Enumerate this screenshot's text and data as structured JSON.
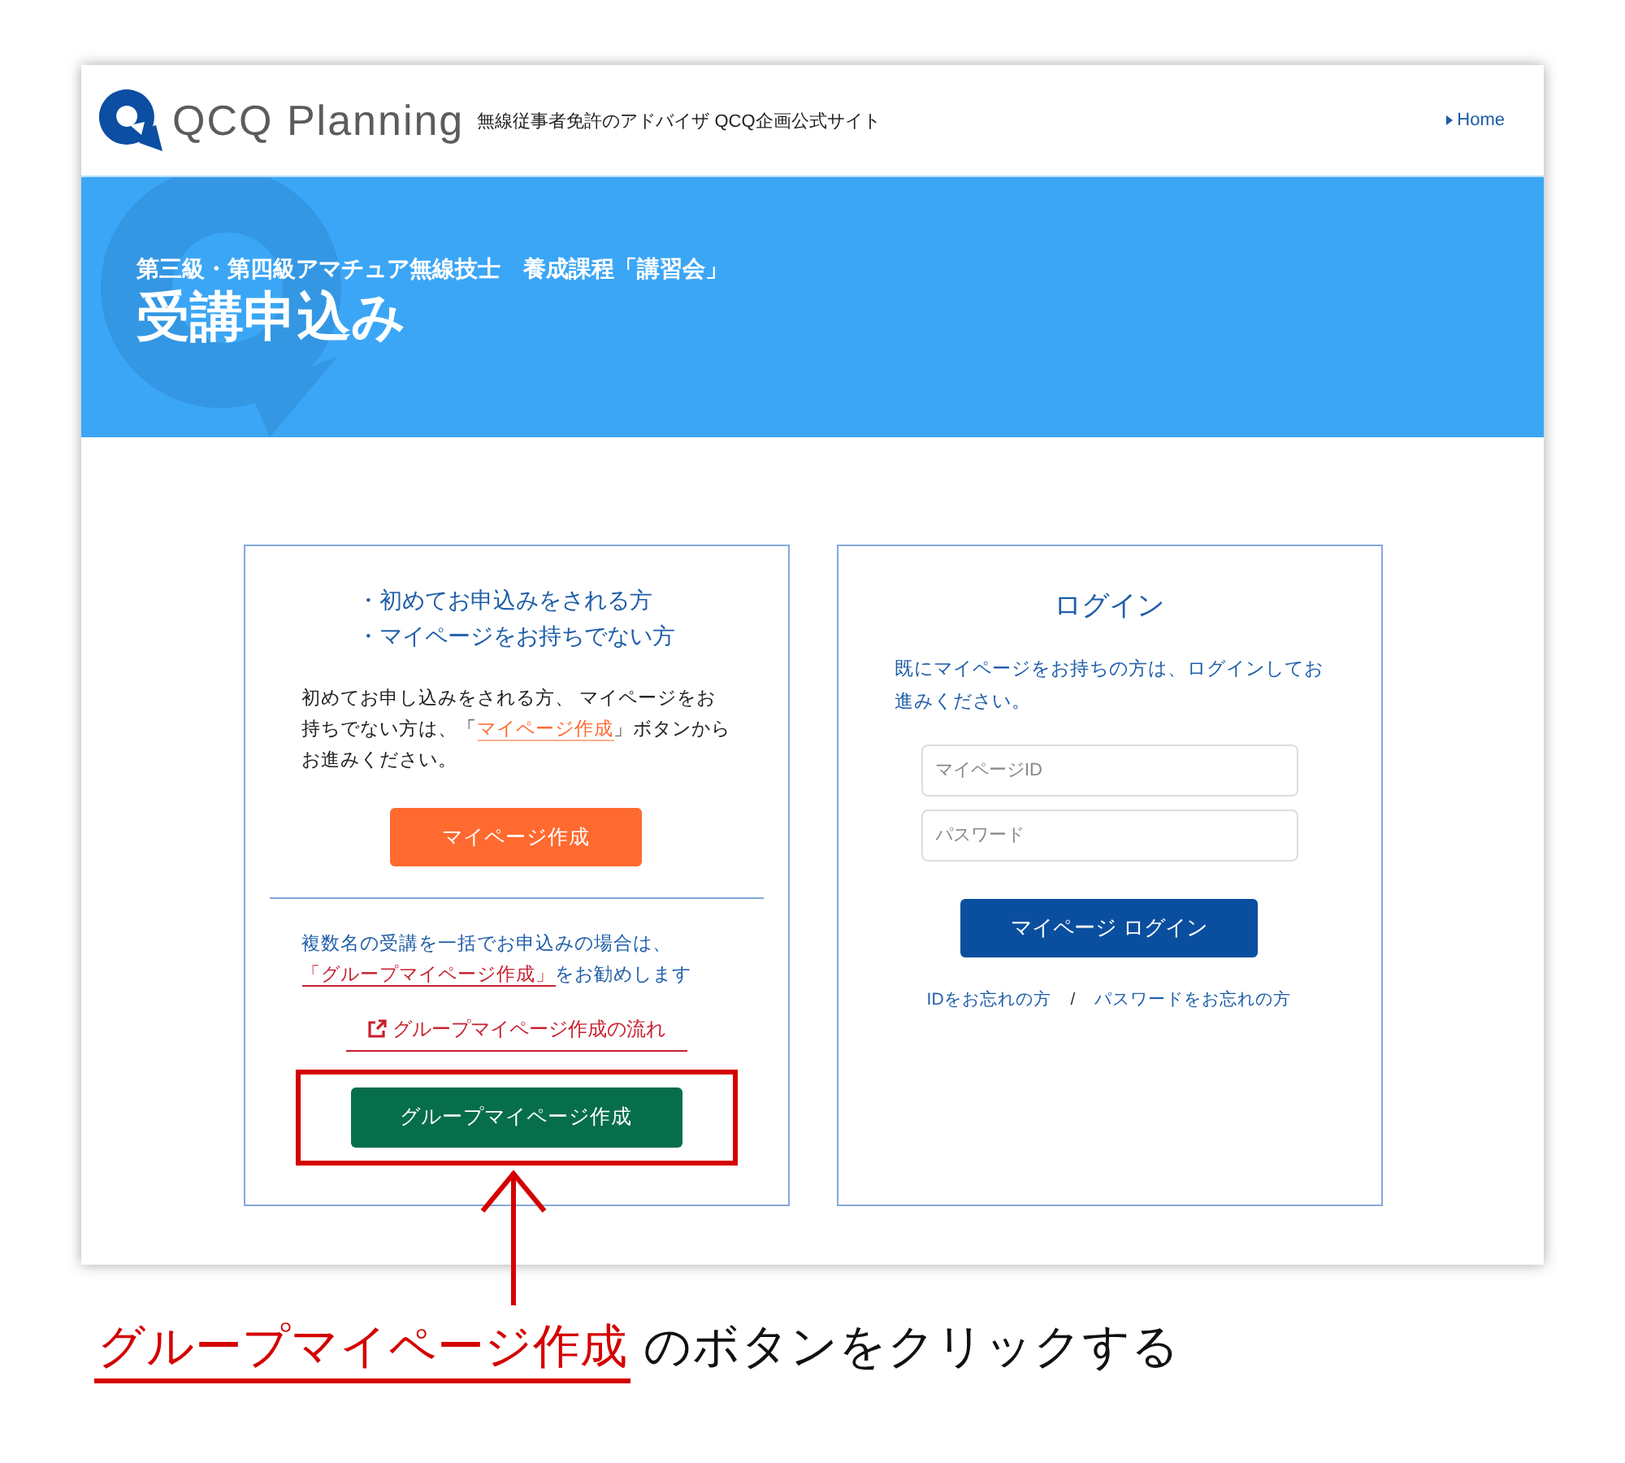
{
  "header": {
    "logo_text": "QCQ Planning",
    "tagline": "無線従事者免許のアドバイザ QCQ企画公式サイト",
    "nav_link": "Home"
  },
  "hero": {
    "subtitle": "第三級・第四級アマチュア無線技士　養成課程「講習会」",
    "title": "受講申込み"
  },
  "new_user_card": {
    "bullets": [
      "・初めてお申込みをされる方",
      "・マイページをお持ちでない方"
    ],
    "description": [
      {
        "kind": "text",
        "text": "初めてお申し込みをされる方、 マイページをお持ちでない方は、「"
      },
      {
        "kind": "link",
        "text": "マイページ作成"
      },
      {
        "kind": "text",
        "text": "」ボタンからお進みください。"
      }
    ],
    "create_button": "マイページ作成",
    "group_note": [
      {
        "kind": "text",
        "text": "複数名の受講を一括でお申込みの場合は、"
      },
      {
        "kind": "link",
        "text": "「グループマイページ作成」"
      },
      {
        "kind": "text",
        "text": "をお勧めします"
      }
    ],
    "flow_link": "グループマイページ作成の流れ",
    "group_button": "グループマイページ作成"
  },
  "login_card": {
    "title": "ログイン",
    "description": "既にマイページをお持ちの方は、ログインしてお進みください。",
    "fields": [
      {
        "placeholder": "マイページID"
      },
      {
        "placeholder": "パスワード"
      }
    ],
    "login_button": "マイページ ログイン",
    "links": [
      "IDをお忘れの方",
      "パスワードをお忘れの方"
    ],
    "separator": "/"
  },
  "annotation": {
    "highlight": "グループマイページ作成",
    "text": "のボタンをクリックする"
  }
}
